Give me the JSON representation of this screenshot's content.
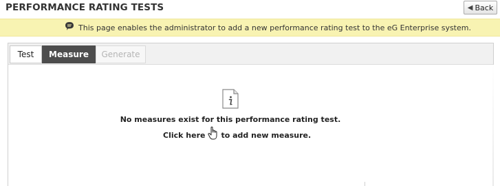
{
  "header": {
    "title": "PERFORMANCE RATING TESTS",
    "back_label": "Back"
  },
  "banner": {
    "text": "This page enables the administrator to add a new performance rating test to the eG Enterprise system.",
    "background_color": "#f8f3b2",
    "icon": "speech-bubble-icon"
  },
  "tabs": [
    {
      "label": "Test",
      "state": "normal"
    },
    {
      "label": "Measure",
      "state": "active"
    },
    {
      "label": "Generate",
      "state": "disabled"
    }
  ],
  "main": {
    "icon": "info-document-icon",
    "empty_message": "No measures exist for this performance rating test.",
    "click_here_label": "Click here",
    "add_suffix": "to add new measure.",
    "cursor_icon": "hand-pointer-icon"
  },
  "colors": {
    "active_tab_bg": "#4d4d4d",
    "active_tab_text": "#ffffff",
    "disabled_tab_text": "#b5b5b5"
  }
}
